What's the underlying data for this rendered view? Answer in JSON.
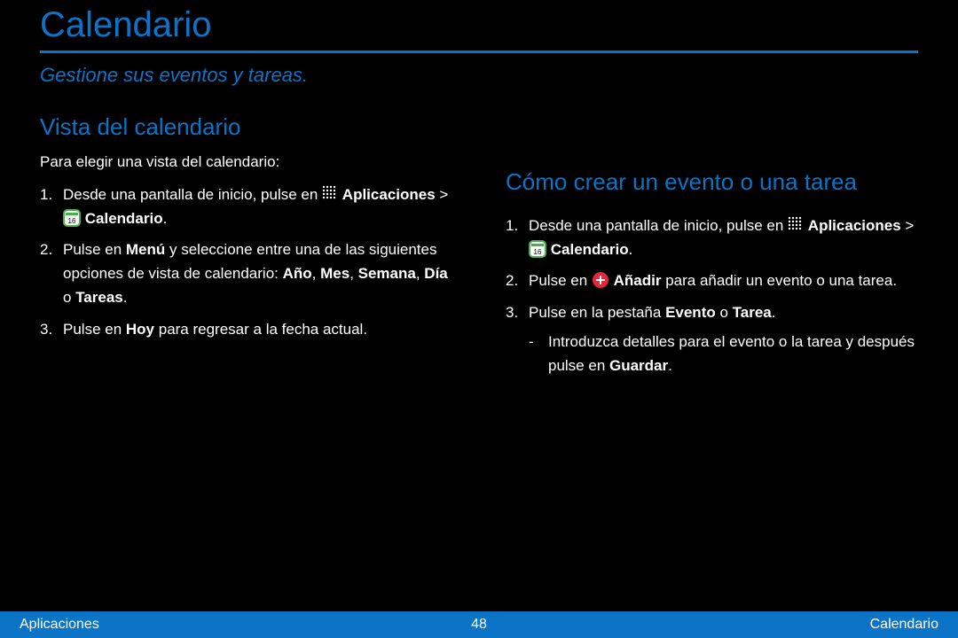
{
  "title": "Calendario",
  "subtitle": "Gestione sus eventos y tareas.",
  "left": {
    "heading": "Vista del calendario",
    "intro": "Para elegir una vista del calendario:",
    "step1_num": "1.",
    "step1_prefix": "Desde una pantalla de inicio, pulse en",
    "step1_apps": "Aplicaciones",
    "step1_sep": " > ",
    "step1_cal": "Calendario",
    "step1_suffix": ".",
    "step2_num": "2.",
    "step2_prefix": "Pulse en ",
    "step2_bold": "Menú",
    "step2_mid": " y seleccione entre una de las siguientes opciones de vista de calendario: ",
    "step2_bold2": "Año",
    "step2_c1": ", ",
    "step2_bold3": "Mes",
    "step2_c2": ", ",
    "step2_bold4": "Semana",
    "step2_c3": ", ",
    "step2_bold5": "Día",
    "step2_c4": " o ",
    "step2_bold6": "Tareas",
    "step2_end": ".",
    "step3_num": "3.",
    "step3_prefix": "Pulse en ",
    "step3_bold": "Hoy",
    "step3_suffix": " para regresar a la fecha actual."
  },
  "right": {
    "heading": "Cómo crear un evento o una tarea",
    "step1_num": "1.",
    "step1_prefix": "Desde una pantalla de inicio, pulse en",
    "step1_apps": "Aplicaciones",
    "step1_sep": " > ",
    "step1_cal": "Calendario",
    "step1_suffix": ".",
    "step2_num": "2.",
    "step2_prefix": "Pulse en ",
    "step2_bold": "Añadir",
    "step2_suffix": " para añadir un evento o una tarea.",
    "step3_num": "3.",
    "step3_prefix": "Pulse en la pestaña ",
    "step3_bold": "Evento",
    "step3_mid": " o ",
    "step3_bold2": "Tarea",
    "step3_suffix": ".",
    "sub_dash": "-",
    "sub_prefix": "Introduzca detalles para el evento o la tarea y después pulse en ",
    "sub_bold": "Guardar",
    "sub_suffix": "."
  },
  "footer": {
    "left": "Aplicaciones",
    "center": "48",
    "right": "Calendario"
  }
}
